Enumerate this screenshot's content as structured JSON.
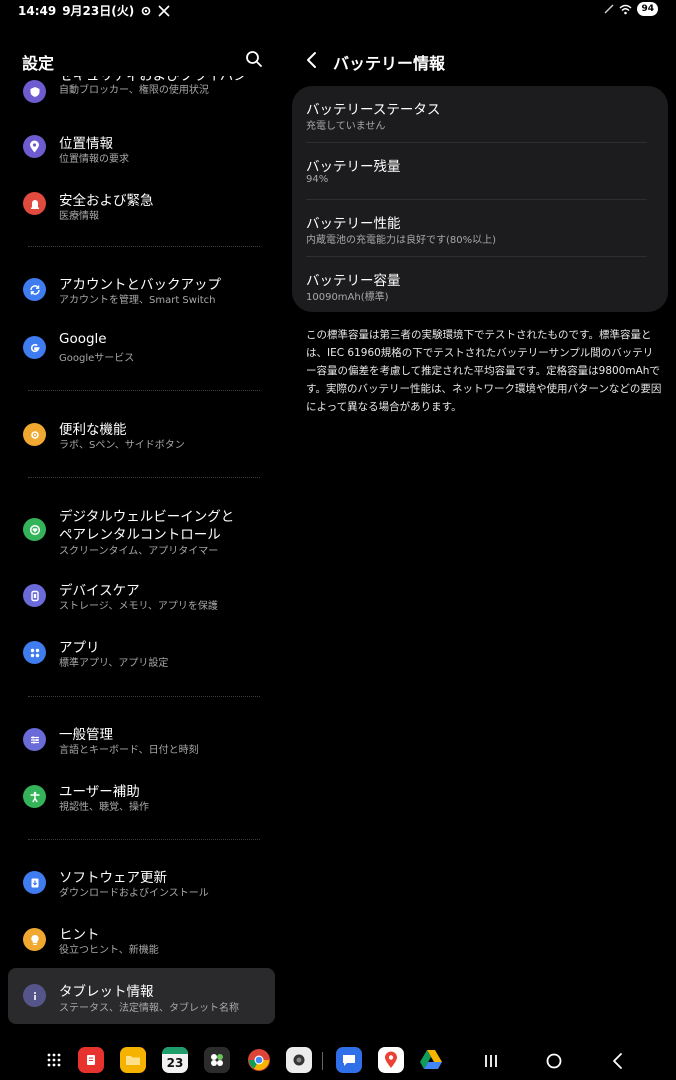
{
  "status_bar": {
    "time": "14:49",
    "date": "9月23日(火)",
    "battery": "94"
  },
  "left_pane": {
    "title": "設定",
    "items": [
      {
        "title": "セキュリティおよびプライバシー",
        "subtitle": "自動ブロッカー、権限の使用状況",
        "icon": "shield-icon",
        "color": "#6d5bd0"
      },
      {
        "title": "位置情報",
        "subtitle": "位置情報の要求",
        "icon": "location-pin-icon",
        "color": "#6d5bd0"
      },
      {
        "title": "安全および緊急",
        "subtitle": "医療情報",
        "icon": "emergency-icon",
        "color": "#e04a3f"
      },
      {
        "title": "アカウントとバックアップ",
        "subtitle": "アカウントを管理、Smart Switch",
        "icon": "sync-icon",
        "color": "#3e7cf0"
      },
      {
        "title": "Google",
        "subtitle": "Googleサービス",
        "icon": "google-icon",
        "color": "#3e7cf0"
      },
      {
        "title": "便利な機能",
        "subtitle": "ラボ、Sペン、サイドボタン",
        "icon": "puzzle-icon",
        "color": "#f0a830"
      },
      {
        "title": "デジタルウェルビーイングと",
        "title2": "ペアレンタルコントロール",
        "subtitle": "スクリーンタイム、アプリタイマー",
        "icon": "wellbeing-icon",
        "color": "#35b35a"
      },
      {
        "title": "デバイスケア",
        "subtitle": "ストレージ、メモリ、アプリを保護",
        "icon": "device-care-icon",
        "color": "#6a6ad8"
      },
      {
        "title": "アプリ",
        "subtitle": "標準アプリ、アプリ設定",
        "icon": "apps-grid-icon",
        "color": "#3e7cf0"
      },
      {
        "title": "一般管理",
        "subtitle": "言語とキーボード、日付と時刻",
        "icon": "sliders-icon",
        "color": "#6a6ad8"
      },
      {
        "title": "ユーザー補助",
        "subtitle": "視認性、聴覚、操作",
        "icon": "accessibility-icon",
        "color": "#35b35a"
      },
      {
        "title": "ソフトウェア更新",
        "subtitle": "ダウンロードおよびインストール",
        "icon": "software-update-icon",
        "color": "#3e7cf0"
      },
      {
        "title": "ヒント",
        "subtitle": "役立つヒント、新機能",
        "icon": "lightbulb-icon",
        "color": "#f0a830"
      },
      {
        "title": "タブレット情報",
        "subtitle": "ステータス、法定情報、タブレット名称",
        "icon": "info-icon",
        "color": "#6a6ad8"
      }
    ]
  },
  "right_pane": {
    "title": "バッテリー情報",
    "rows": [
      {
        "title": "バッテリーステータス",
        "subtitle": "充電していません"
      },
      {
        "title": "バッテリー残量",
        "subtitle": "94%"
      },
      {
        "title": "バッテリー性能",
        "subtitle": "内蔵電池の充電能力は良好です(80%以上)"
      },
      {
        "title": "バッテリー容量",
        "subtitle": "10090mAh(標準)"
      }
    ],
    "note": "この標準容量は第三者の実験環境下でテストされたものです。標準容量とは、IEC 61960規格の下でテストされたバッテリーサンプル間のバッテリー容量の偏差を考慮して推定された平均容量です。定格容量は9800mAhです。実際のバッテリー性能は、ネットワーク環境や使用パターンなどの要因によって異なる場合があります。"
  },
  "taskbar": {
    "calendar_day": "23"
  }
}
